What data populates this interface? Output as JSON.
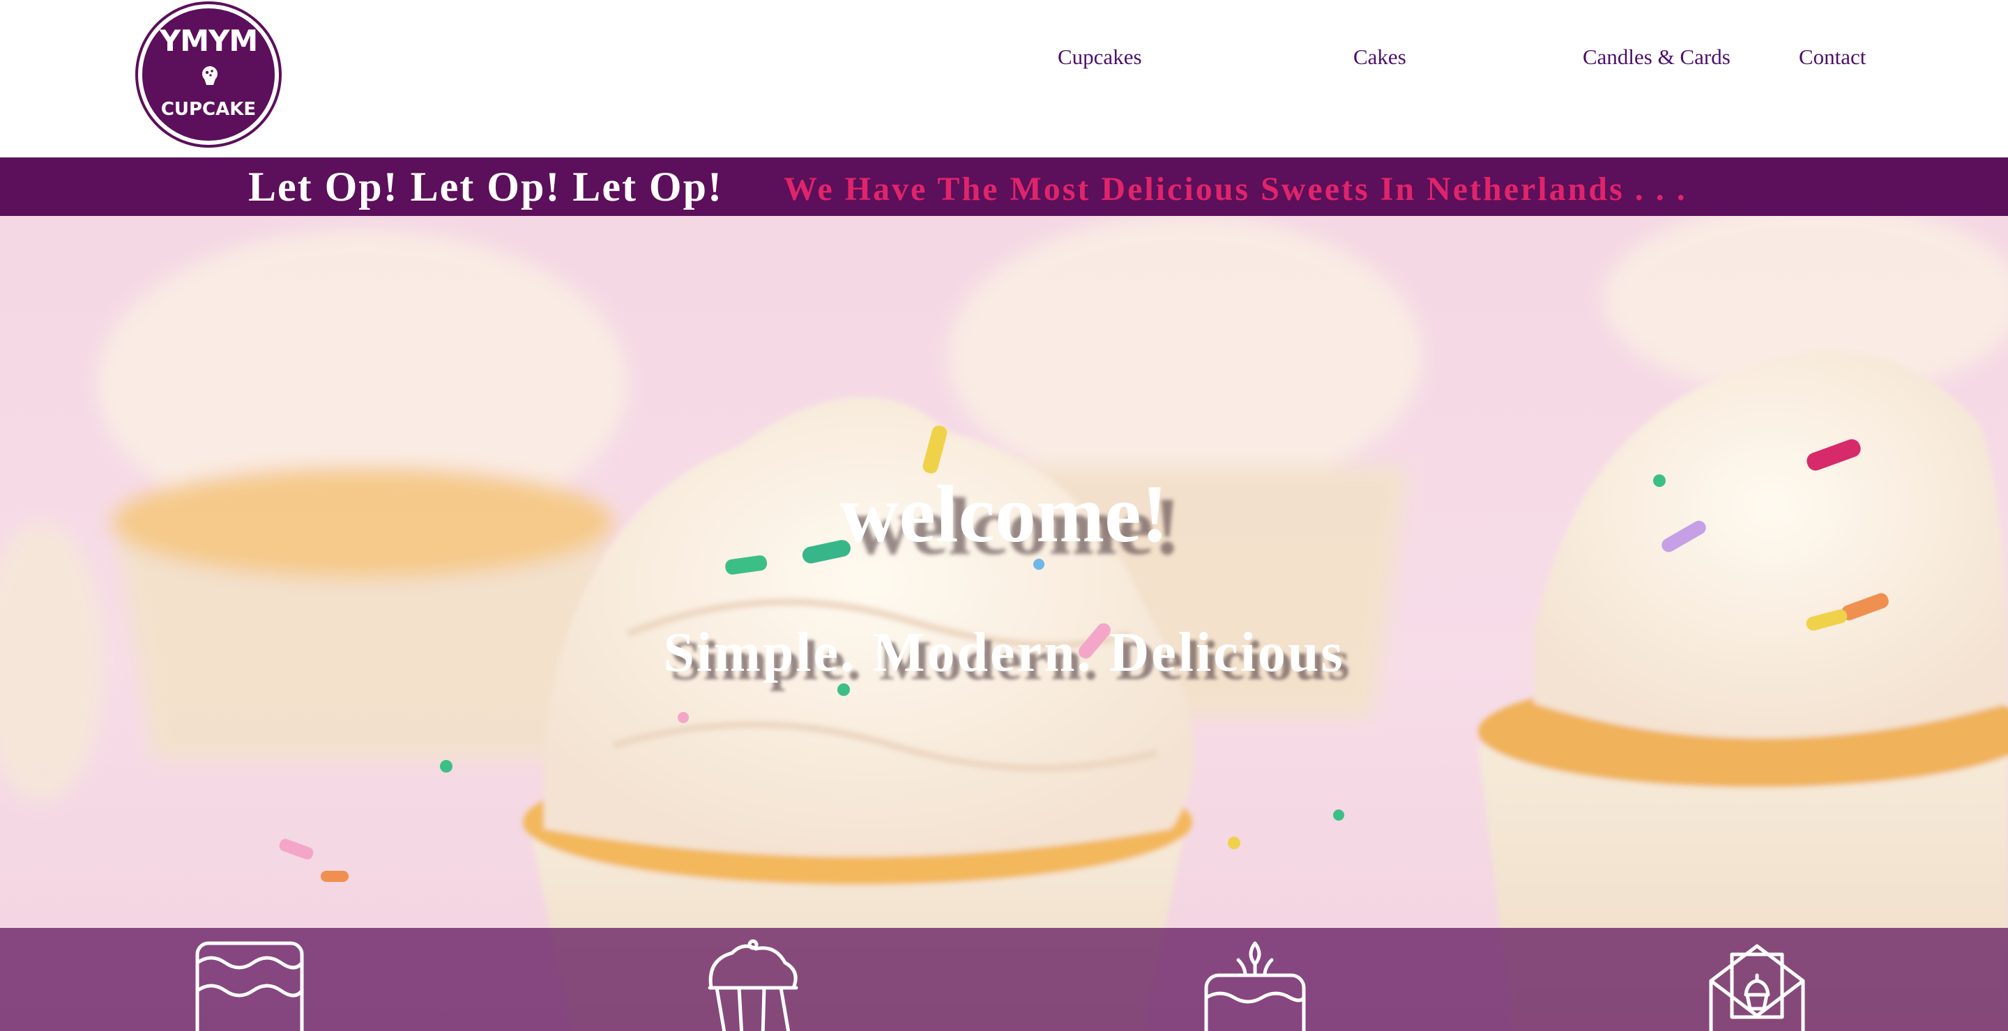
{
  "header": {
    "logo": {
      "top_text": "YMYM",
      "bottom_text": "CUPCAKE",
      "mark_icon": "cupcake-icon",
      "color": "#5c0f5a"
    },
    "nav": [
      {
        "label": "Cupcakes"
      },
      {
        "label": "Cakes"
      },
      {
        "label": "Candles & Cards"
      },
      {
        "label": "Contact"
      }
    ],
    "nav_color": "#4b0f6b"
  },
  "announcement": {
    "primary": "Let Op! Let Op! Let Op!",
    "secondary": "We Have The Most Delicious Sweets In Netherlands . . .",
    "background": "#5c0f5a",
    "primary_color": "#ffffff",
    "secondary_color": "#e0246b"
  },
  "hero": {
    "title": "welcome!",
    "subtitle": "Simple. Modern. Delicious"
  },
  "categories": [
    {
      "icon": "cake-icon"
    },
    {
      "icon": "cupcake-icon"
    },
    {
      "icon": "birthday-candle-cake-icon"
    },
    {
      "icon": "greeting-card-envelope-icon"
    }
  ],
  "category_strip_color": "#5c0f5a"
}
